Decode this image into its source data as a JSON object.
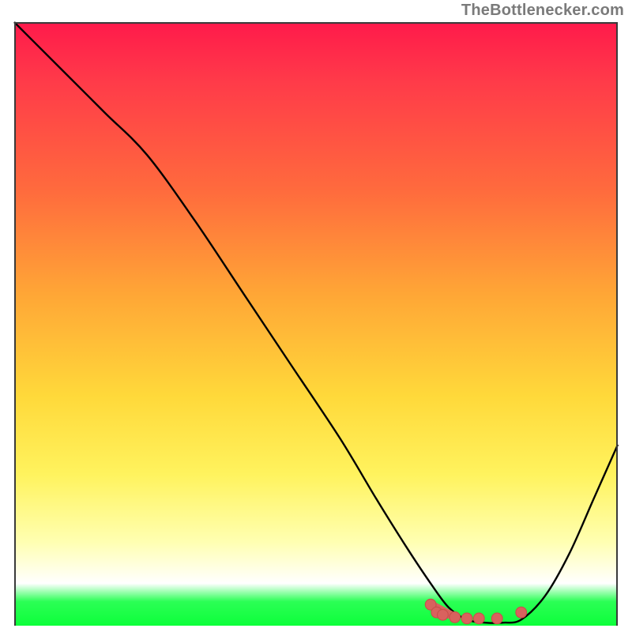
{
  "attribution": "TheBottlenecker.com",
  "colors": {
    "gradient_top": "#ff1a4b",
    "gradient_mid": "#ffd93a",
    "gradient_bottom_green": "#0cff3a",
    "curve_stroke": "#000000",
    "marker_fill": "#d9625e",
    "marker_stroke": "#c94f4b"
  },
  "chart_data": {
    "type": "line",
    "title": "",
    "xlabel": "",
    "ylabel": "",
    "xlim": [
      0,
      100
    ],
    "ylim": [
      0,
      100
    ],
    "x": [
      0,
      3,
      8,
      15,
      22,
      30,
      38,
      46,
      54,
      60,
      65,
      69,
      72,
      75,
      78,
      81,
      84,
      88,
      92,
      96,
      100
    ],
    "values": [
      100,
      97,
      92,
      85,
      78,
      67,
      55,
      43,
      31,
      21,
      13,
      7,
      3,
      1,
      0.5,
      0.5,
      1,
      5,
      12,
      21,
      30
    ],
    "series": [
      {
        "name": "bottleneck-curve",
        "x": [
          0,
          3,
          8,
          15,
          22,
          30,
          38,
          46,
          54,
          60,
          65,
          69,
          72,
          75,
          78,
          81,
          84,
          88,
          92,
          96,
          100
        ],
        "values": [
          100,
          97,
          92,
          85,
          78,
          67,
          55,
          43,
          31,
          21,
          13,
          7,
          3,
          1,
          0.5,
          0.5,
          1,
          5,
          12,
          21,
          30
        ]
      }
    ],
    "markers": [
      {
        "x": 69,
        "y": 3.5
      },
      {
        "x": 70,
        "y": 2.2
      },
      {
        "x": 71,
        "y": 1.8
      },
      {
        "x": 73,
        "y": 1.4
      },
      {
        "x": 75,
        "y": 1.2
      },
      {
        "x": 77,
        "y": 1.2
      },
      {
        "x": 80,
        "y": 1.2
      },
      {
        "x": 84,
        "y": 2.2
      }
    ]
  }
}
